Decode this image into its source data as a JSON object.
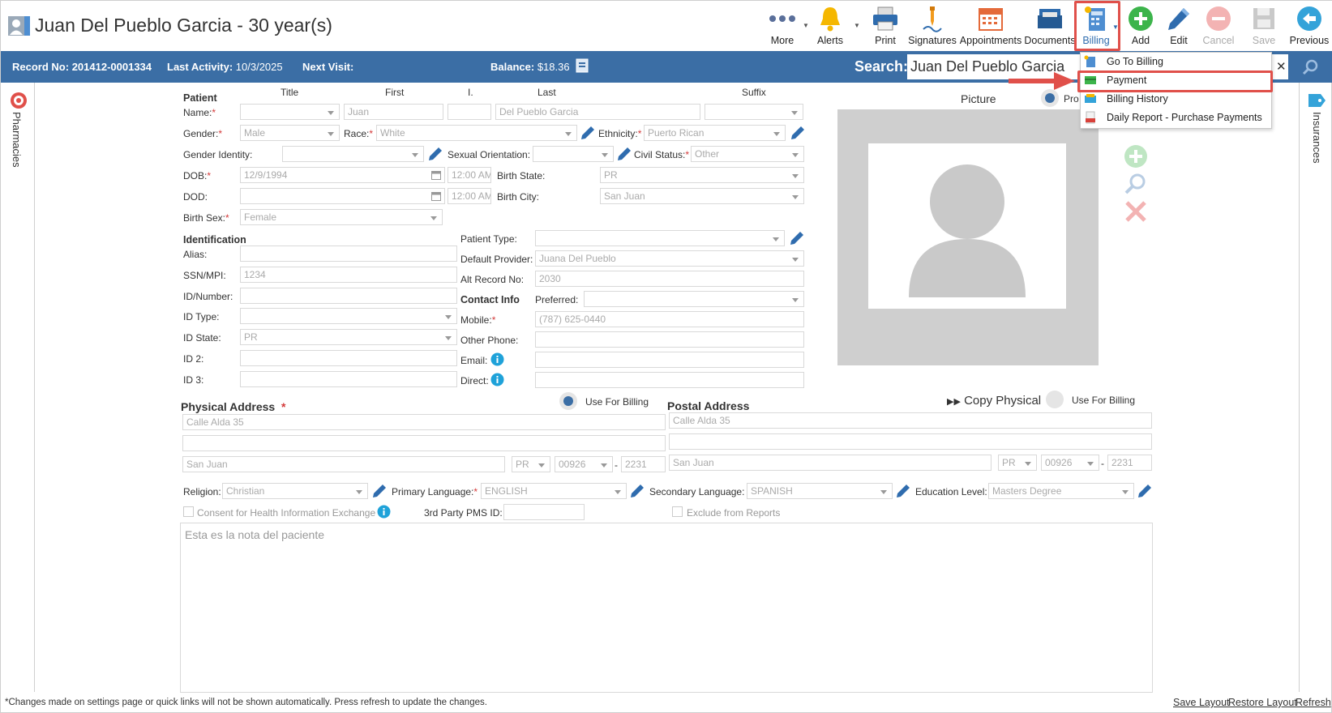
{
  "header": {
    "title": "Juan Del Pueblo Garcia - 30 year(s)",
    "toolbar": {
      "more": "More",
      "alerts": "Alerts",
      "print": "Print",
      "signatures": "Signatures",
      "appointments": "Appointments",
      "documents": "Documents",
      "billing": "Billing",
      "add": "Add",
      "edit": "Edit",
      "cancel": "Cancel",
      "save": "Save",
      "previous": "Previous"
    }
  },
  "infobar": {
    "record_label": "Record No:",
    "record_value": "201412-0001334",
    "activity_label": "Last Activity:",
    "activity_value": "10/3/2025",
    "next_visit_label": "Next Visit:",
    "balance_label": "Balance:",
    "balance_value": "$18.36",
    "search_label": "Search:",
    "search_value": "Juan Del Pueblo Garcia"
  },
  "billing_menu": {
    "items": [
      "Go To Billing",
      "Payment",
      "Billing History",
      "Daily Report - Purchase Payments"
    ]
  },
  "side_tabs": {
    "left": "Pharmacies",
    "right": "Insurances"
  },
  "columns": {
    "title": "Title",
    "first": "First",
    "initial": "I.",
    "last": "Last",
    "suffix": "Suffix"
  },
  "form": {
    "patient_section": "Patient",
    "name_label": "Name:",
    "first_name": "Juan",
    "last_name": "Del Pueblo Garcia",
    "gender_label": "Gender:",
    "gender_value": "Male",
    "race_label": "Race:",
    "race_value": "White",
    "ethnicity_label": "Ethnicity:",
    "ethnicity_value": "Puerto Rican",
    "gender_identity_label": "Gender Identity:",
    "sexual_orientation_label": "Sexual Orientation:",
    "civil_status_label": "Civil Status:",
    "civil_status_value": "Other",
    "dob_label": "DOB:",
    "dob_value": "12/9/1994",
    "dob_time": "12:00 AM",
    "birth_state_label": "Birth State:",
    "birth_state_value": "PR",
    "dod_label": "DOD:",
    "dod_time": "12:00 AM",
    "birth_city_label": "Birth City:",
    "birth_city_value": "San Juan",
    "birth_sex_label": "Birth Sex:",
    "birth_sex_value": "Female",
    "identification_section": "Identification",
    "alias_label": "Alias:",
    "ssn_label": "SSN/MPI:",
    "ssn_value": "1234",
    "id_number_label": "ID/Number:",
    "id_type_label": "ID Type:",
    "id_state_label": "ID State:",
    "id_state_value": "PR",
    "id2_label": "ID 2:",
    "id3_label": "ID 3:",
    "patient_type_label": "Patient Type:",
    "default_provider_label": "Default Provider:",
    "default_provider_value": "Juana Del Pueblo",
    "alt_record_label": "Alt Record No:",
    "alt_record_value": "2030",
    "contact_section": "Contact Info",
    "preferred_label": "Preferred:",
    "mobile_label": "Mobile:",
    "mobile_value": "(787) 625-0440",
    "other_phone_label": "Other Phone:",
    "email_label": "Email:",
    "direct_label": "Direct:",
    "picture_label": "Picture",
    "picture_radio_label": "Pro"
  },
  "physical_address": {
    "title": "Physical Address",
    "use_for_billing": "Use For Billing",
    "line1": "Calle Alda 35",
    "city": "San Juan",
    "state": "PR",
    "zip": "00926",
    "zip_ext": "2231"
  },
  "postal_address": {
    "title": "Postal Address",
    "copy_physical": "Copy Physical",
    "use_for_billing": "Use For Billing",
    "line1": "Calle Alda 35",
    "city": "San Juan",
    "state": "PR",
    "zip": "00926",
    "zip_ext": "2231"
  },
  "bottom": {
    "religion_label": "Religion:",
    "religion_value": "Christian",
    "primary_language_label": "Primary Language:",
    "primary_language_value": "ENGLISH",
    "secondary_language_label": "Secondary Language:",
    "secondary_language_value": "SPANISH",
    "education_label": "Education Level:",
    "education_value": "Masters Degree",
    "consent_label": "Consent for Health Information Exchange",
    "third_party_label": "3rd Party PMS ID:",
    "exclude_label": "Exclude from Reports",
    "notes": "Esta es la nota del paciente"
  },
  "footer": {
    "note": "*Changes made on settings page or quick links will not be shown automatically. Press refresh to update the changes.",
    "save_layout": "Save Layout",
    "restore_layout": "Restore Layout",
    "refresh": "Refresh"
  },
  "colors": {
    "blue_bar": "#3b6ea5",
    "highlight": "#e0504a",
    "required": "#d43a3a"
  }
}
